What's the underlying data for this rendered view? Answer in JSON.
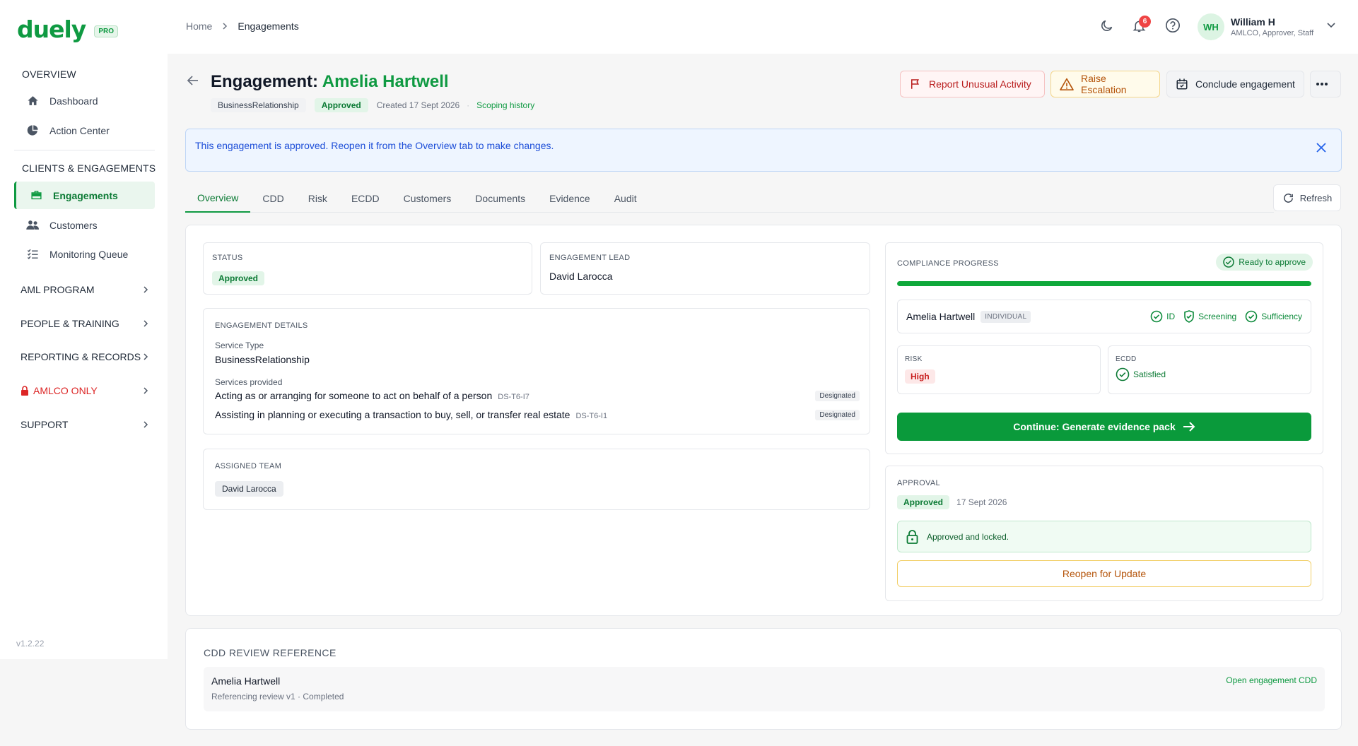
{
  "brand": {
    "name": "duely",
    "tier": "PRO",
    "accent": "#0f9a42"
  },
  "sidebar": {
    "sections": [
      {
        "title": "OVERVIEW",
        "items": [
          {
            "label": "Dashboard",
            "icon": "home-icon"
          },
          {
            "label": "Action Center",
            "icon": "pie-chart-icon"
          }
        ]
      },
      {
        "title": "CLIENTS & ENGAGEMENTS",
        "items": [
          {
            "label": "Engagements",
            "icon": "briefcase-icon",
            "active": true
          },
          {
            "label": "Customers",
            "icon": "users-icon"
          },
          {
            "label": "Monitoring Queue",
            "icon": "list-check-icon"
          }
        ]
      }
    ],
    "groups": [
      {
        "label": "AML PROGRAM"
      },
      {
        "label": "PEOPLE & TRAINING"
      },
      {
        "label": "REPORTING & RECORDS"
      },
      {
        "label": "AMLCO ONLY",
        "icon": "lock-icon",
        "color": "#dc2626"
      },
      {
        "label": "SUPPORT"
      }
    ],
    "version": "v1.2.22"
  },
  "header": {
    "breadcrumb": [
      "Home",
      "Engagements"
    ],
    "notifications_count": "6",
    "user": {
      "initials": "WH",
      "name": "William H",
      "role": "AMLCO, Approver, Staff"
    }
  },
  "engagement": {
    "title_prefix": "Engagement: ",
    "client_name": "Amelia Hartwell",
    "type": "BusinessRelationship",
    "status": "Approved",
    "created": "Created 17 Sept 2026",
    "separator": "·",
    "scoping_link": "Scoping history"
  },
  "actions": {
    "report": "Report Unusual Activity",
    "raise": "Raise Escalation",
    "conclude": "Conclude engagement"
  },
  "banner": {
    "text": "This engagement is approved. Reopen it from the Overview tab to make changes."
  },
  "tabs": [
    "Overview",
    "CDD",
    "Risk",
    "ECDD",
    "Customers",
    "Documents",
    "Evidence",
    "Audit"
  ],
  "active_tab": "Overview",
  "refresh_label": "Refresh",
  "overview": {
    "status": {
      "label": "STATUS",
      "value": "Approved"
    },
    "lead": {
      "label": "ENGAGEMENT LEAD",
      "value": "David Larocca"
    },
    "details": {
      "label": "ENGAGEMENT DETAILS",
      "service_type_label": "Service Type",
      "service_type": "BusinessRelationship",
      "services_label": "Services provided",
      "services": [
        {
          "name": "Acting as or arranging for someone to act on behalf of a person",
          "code": "DS-T6-I7",
          "tag": "Designated"
        },
        {
          "name": "Assisting in planning or executing a transaction to buy, sell, or transfer real estate",
          "code": "DS-T6-I1",
          "tag": "Designated"
        }
      ]
    },
    "team": {
      "label": "ASSIGNED TEAM",
      "members": [
        "David Larocca"
      ]
    }
  },
  "compliance": {
    "label": "COMPLIANCE PROGRESS",
    "ready": "Ready to approve",
    "progress": 1.0,
    "customer": {
      "name": "Amelia Hartwell",
      "kind": "INDIVIDUAL",
      "checks": [
        "ID",
        "Screening",
        "Sufficiency"
      ]
    },
    "risk": {
      "label": "RISK",
      "value": "High"
    },
    "ecdd": {
      "label": "ECDD",
      "value": "Satisfied"
    },
    "cta": "Continue: Generate evidence pack"
  },
  "approval": {
    "label": "APPROVAL",
    "status": "Approved",
    "date": "17 Sept 2026",
    "locked_text": "Approved and locked.",
    "reopen": "Reopen for Update"
  },
  "cdd_ref": {
    "title": "CDD REVIEW REFERENCE",
    "name": "Amelia Hartwell",
    "sub": "Referencing review v1 · Completed",
    "link": "Open engagement CDD"
  }
}
